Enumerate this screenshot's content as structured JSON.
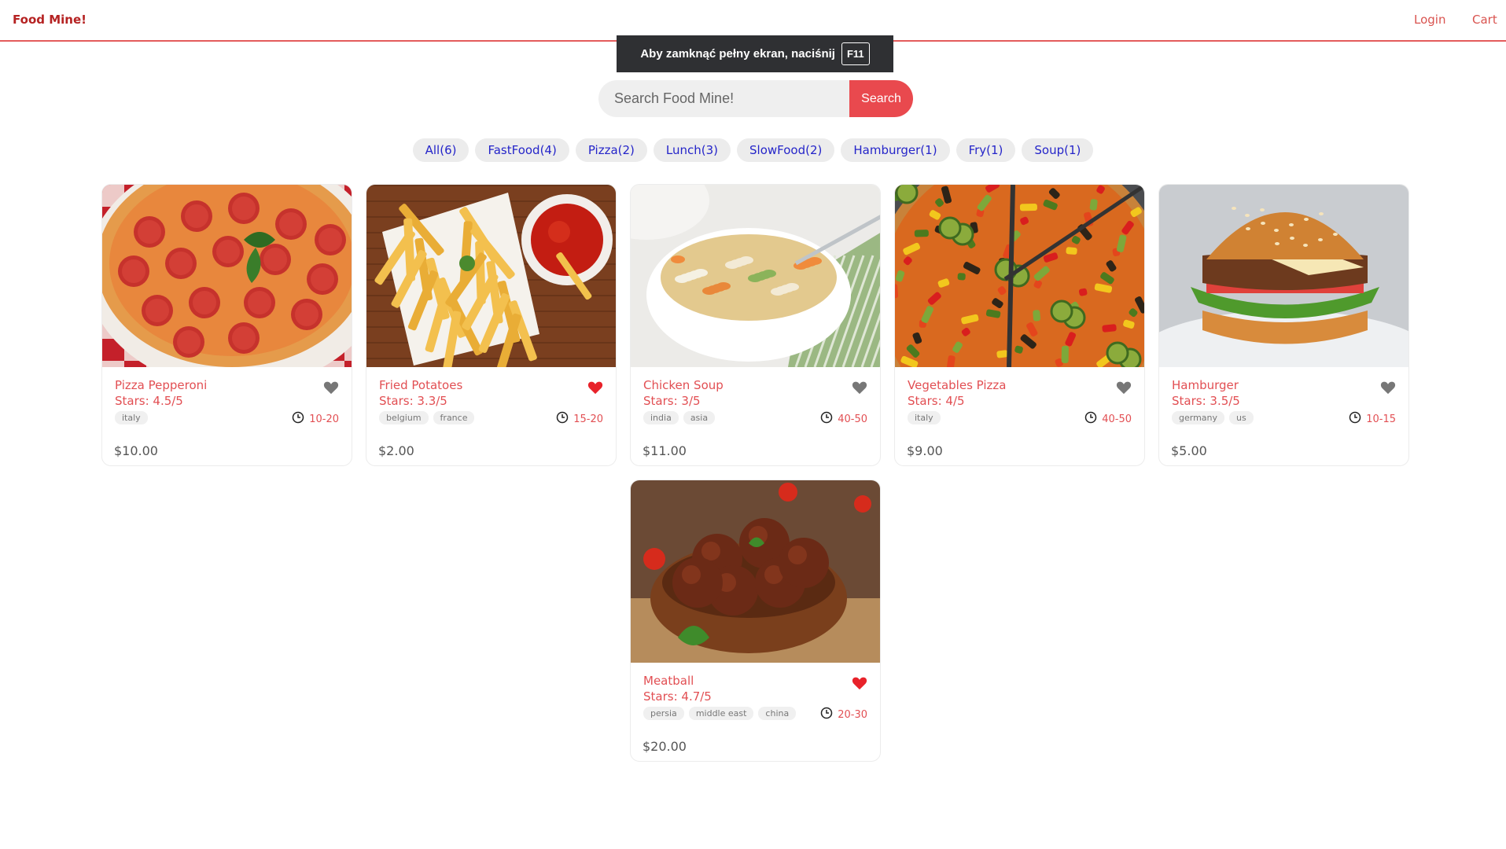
{
  "header": {
    "logo": "Food Mine!",
    "login": "Login",
    "cart": "Cart"
  },
  "fullscreen_notice": {
    "text": "Aby zamknąć pełny ekran, naciśnij",
    "key": "F11"
  },
  "search": {
    "placeholder": "Search Food Mine!",
    "button": "Search"
  },
  "tags": [
    "All(6)",
    "FastFood(4)",
    "Pizza(2)",
    "Lunch(3)",
    "SlowFood(2)",
    "Hamburger(1)",
    "Fry(1)",
    "Soup(1)"
  ],
  "foods": [
    {
      "name": "Pizza Pepperoni",
      "stars": "Stars: 4.5/5",
      "origins": [
        "italy"
      ],
      "cook_time": "10-20",
      "price": "$10.00",
      "favorite": false,
      "image": "pizza-pepperoni"
    },
    {
      "name": "Fried Potatoes",
      "stars": "Stars: 3.3/5",
      "origins": [
        "belgium",
        "france"
      ],
      "cook_time": "15-20",
      "price": "$2.00",
      "favorite": true,
      "image": "fried-potatoes"
    },
    {
      "name": "Chicken Soup",
      "stars": "Stars: 3/5",
      "origins": [
        "india",
        "asia"
      ],
      "cook_time": "40-50",
      "price": "$11.00",
      "favorite": false,
      "image": "chicken-soup"
    },
    {
      "name": "Vegetables Pizza",
      "stars": "Stars: 4/5",
      "origins": [
        "italy"
      ],
      "cook_time": "40-50",
      "price": "$9.00",
      "favorite": false,
      "image": "vegetables-pizza"
    },
    {
      "name": "Hamburger",
      "stars": "Stars: 3.5/5",
      "origins": [
        "germany",
        "us"
      ],
      "cook_time": "10-15",
      "price": "$5.00",
      "favorite": false,
      "image": "hamburger"
    },
    {
      "name": "Meatball",
      "stars": "Stars: 4.7/5",
      "origins": [
        "persia",
        "middle east",
        "china"
      ],
      "cook_time": "20-30",
      "price": "$20.00",
      "favorite": true,
      "image": "meatball"
    }
  ],
  "colors": {
    "accent": "#e9494e",
    "favorite_on": "#e8222a",
    "favorite_off": "#777777",
    "tag_text": "#2525c9"
  }
}
